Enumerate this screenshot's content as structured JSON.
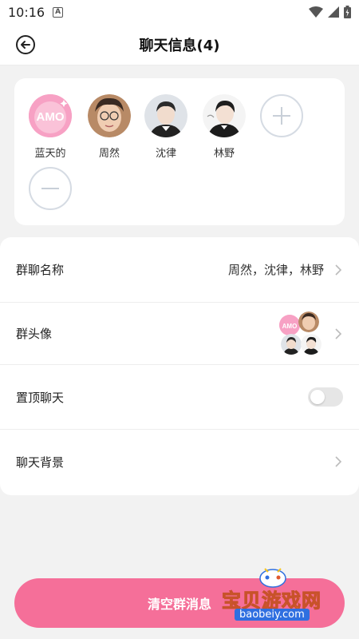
{
  "status_bar": {
    "time": "10:16",
    "notification_letter": "A"
  },
  "header": {
    "title": "聊天信息(4)",
    "back_icon": "back-arrow-icon"
  },
  "members": [
    {
      "name": "蓝天的",
      "avatar_text": "AMO",
      "avatar_color": "#f7a1c4"
    },
    {
      "name": "周然"
    },
    {
      "name": "沈律"
    },
    {
      "name": "林野"
    }
  ],
  "member_actions": {
    "add_icon": "plus-icon",
    "remove_icon": "minus-icon"
  },
  "settings": {
    "group_name": {
      "label": "群聊名称",
      "value": "周然，沈律，林野"
    },
    "group_avatar": {
      "label": "群头像"
    },
    "pin_chat": {
      "label": "置顶聊天",
      "on": false
    },
    "chat_background": {
      "label": "聊天背景"
    }
  },
  "clear_button": {
    "label": "清空群消息",
    "color": "#f56f99"
  },
  "watermark": {
    "text": "宝贝游戏网",
    "url": "baobeiy.com"
  }
}
